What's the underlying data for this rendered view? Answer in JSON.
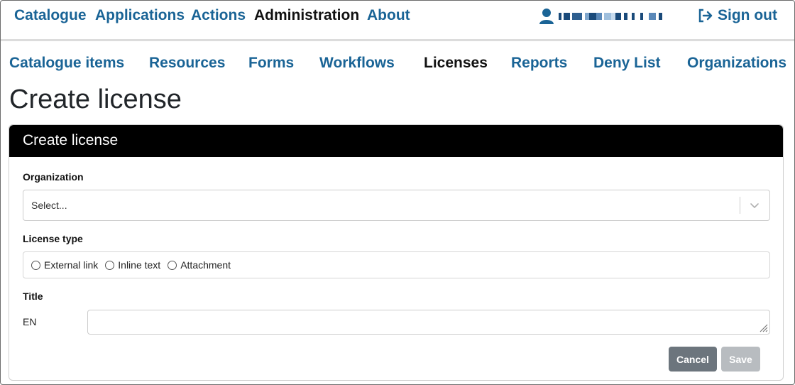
{
  "topnav": {
    "catalogue": "Catalogue",
    "applications": "Applications",
    "actions": "Actions",
    "administration": "Administration",
    "about": "About",
    "sign_out": "Sign out"
  },
  "user": {
    "icon": "user-icon",
    "name_redacted": true
  },
  "subnav": {
    "catalogue_items": "Catalogue items",
    "resources": "Resources",
    "forms": "Forms",
    "workflows": "Workflows",
    "licenses": "Licenses",
    "reports": "Reports",
    "deny_list": "Deny List",
    "organizations": "Organizations",
    "active": "Licenses"
  },
  "page": {
    "title": "Create license"
  },
  "card": {
    "header": "Create license",
    "organization": {
      "label": "Organization",
      "placeholder": "Select..."
    },
    "license_type": {
      "label": "License type",
      "options": [
        "External link",
        "Inline text",
        "Attachment"
      ]
    },
    "title": {
      "label": "Title",
      "languages": [
        {
          "code": "EN",
          "value": ""
        }
      ]
    },
    "buttons": {
      "cancel": "Cancel",
      "save": "Save"
    }
  },
  "colors": {
    "link": "#1a6496",
    "active": "#111111",
    "header_bg": "#000000",
    "cancel_bg": "#6c757d",
    "save_bg_disabled": "#b8bcc0"
  }
}
